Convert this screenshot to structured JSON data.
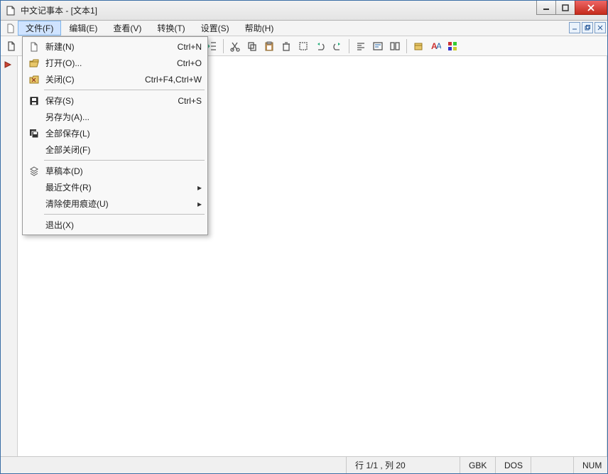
{
  "title": "中文记事本 - [文本1]",
  "menubar": [
    "文件(F)",
    "编辑(E)",
    "查看(V)",
    "转换(T)",
    "设置(S)",
    "帮助(H)"
  ],
  "file_menu": [
    {
      "icon": "new",
      "label": "新建(N)",
      "short": "Ctrl+N"
    },
    {
      "icon": "open",
      "label": "打开(O)...",
      "short": "Ctrl+O"
    },
    {
      "icon": "close",
      "label": "关闭(C)",
      "short": "Ctrl+F4,Ctrl+W"
    },
    {
      "sep": true
    },
    {
      "icon": "save",
      "label": "保存(S)",
      "short": "Ctrl+S"
    },
    {
      "icon": "",
      "label": "另存为(A)...",
      "short": ""
    },
    {
      "icon": "saveall",
      "label": "全部保存(L)",
      "short": ""
    },
    {
      "icon": "",
      "label": "全部关闭(F)",
      "short": ""
    },
    {
      "sep": true
    },
    {
      "icon": "draft",
      "label": "草稿本(D)",
      "short": ""
    },
    {
      "icon": "",
      "label": "最近文件(R)",
      "short": "",
      "sub": true
    },
    {
      "icon": "",
      "label": "清除使用痕迹(U)",
      "short": "",
      "sub": true
    },
    {
      "sep": true
    },
    {
      "icon": "",
      "label": "退出(X)",
      "short": ""
    }
  ],
  "status": {
    "pos": "行 1/1 , 列 20",
    "enc": "GBK",
    "eol": "DOS",
    "num": "NUM"
  }
}
